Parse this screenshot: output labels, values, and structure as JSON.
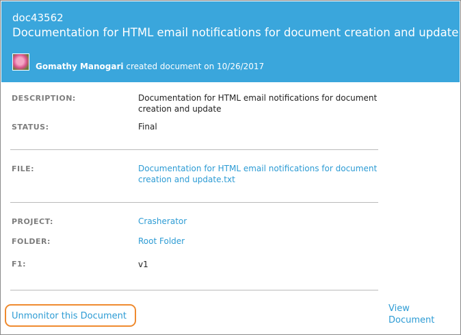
{
  "header": {
    "doc_id": "doc43562",
    "title": "Documentation for HTML email notifications for document creation and update",
    "author": "Gomathy Manogari",
    "action_text": "created document on 10/26/2017"
  },
  "fields": {
    "description": {
      "label": "DESCRIPTION:",
      "value": "Documentation for HTML email notifications for document creation and update"
    },
    "status": {
      "label": "STATUS:",
      "value": "Final"
    },
    "file": {
      "label": "FILE:",
      "value": "Documentation for HTML email notifications for document creation and update.txt"
    },
    "project": {
      "label": "PROJECT:",
      "value": "Crasherator"
    },
    "folder": {
      "label": "FOLDER:",
      "value": "Root Folder"
    },
    "f1": {
      "label": "F1:",
      "value": "v1"
    }
  },
  "actions": {
    "unmonitor": "Unmonitor this Document",
    "view": "View Document"
  },
  "colors": {
    "header_bg": "#3aa6dc",
    "link": "#2c9bd4",
    "highlight": "#ef8a2e"
  },
  "icons": {
    "avatar": "user-avatar-icon"
  }
}
